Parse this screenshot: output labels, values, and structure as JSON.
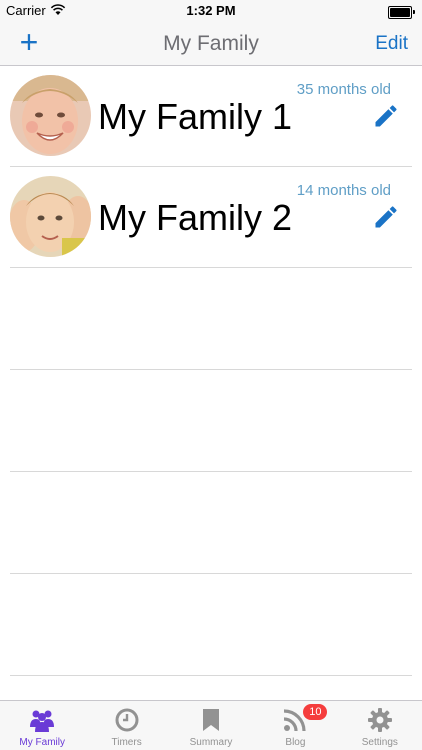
{
  "status_bar": {
    "carrier": "Carrier",
    "time": "1:32 PM"
  },
  "nav": {
    "add_label": "+",
    "title": "My Family",
    "edit_label": "Edit"
  },
  "families": [
    {
      "name": "My Family 1",
      "age": "35 months old"
    },
    {
      "name": "My Family 2",
      "age": "14 months old"
    }
  ],
  "tabs": [
    {
      "label": "My Family",
      "icon": "family-icon",
      "active": true
    },
    {
      "label": "Timers",
      "icon": "clock-icon",
      "active": false
    },
    {
      "label": "Summary",
      "icon": "bookmark-icon",
      "active": false
    },
    {
      "label": "Blog",
      "icon": "rss-icon",
      "active": false,
      "badge": "10"
    },
    {
      "label": "Settings",
      "icon": "gear-icon",
      "active": false
    }
  ],
  "colors": {
    "accent": "#1a73c6",
    "age_text": "#5f9ec6",
    "active_tab": "#6a3bd6",
    "badge": "#f53d3d"
  }
}
